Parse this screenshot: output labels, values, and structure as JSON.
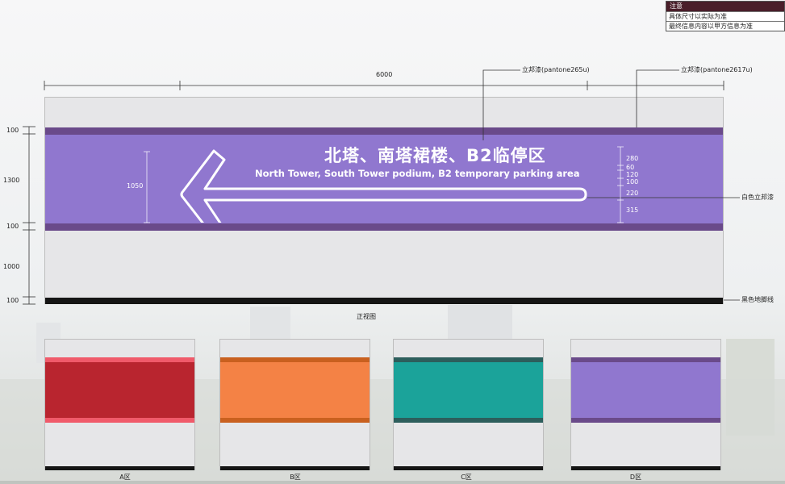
{
  "notice": {
    "title": "注意",
    "lines": [
      "具体尺寸以实际为准",
      "最终信息内容以甲方信息为准"
    ]
  },
  "front_view": {
    "width_dim": "6000",
    "height_dims": [
      "100",
      "1300",
      "100",
      "1000",
      "100"
    ],
    "arrow_height_dim": "1050",
    "text_dims": [
      "280",
      "60",
      "120",
      "100",
      "220",
      "315"
    ],
    "sign_cn": "北塔、南塔裙楼、B2临停区",
    "sign_en": "North Tower, South Tower podium, B2 temporary parking area",
    "callouts": {
      "paint_main": "立邦漆(pantone265u)",
      "paint_stripe": "立邦漆(pantone2617u)",
      "paint_white": "白色立邦漆",
      "baseboard": "黑色地脚线"
    },
    "caption": "正视图"
  },
  "colors": {
    "wall": "#e6e6e8",
    "purple_main": "#9077cf",
    "purple_stripe": "#6a4a8a",
    "baseboard": "#151515"
  },
  "zones": [
    {
      "label": "A区",
      "main": "#b9252f",
      "stripe": "#f05a6a"
    },
    {
      "label": "B区",
      "main": "#f48245",
      "stripe": "#c9601f"
    },
    {
      "label": "C区",
      "main": "#1ba39a",
      "stripe": "#2d5e5c"
    },
    {
      "label": "D区",
      "main": "#9077cf",
      "stripe": "#6a4a8a"
    }
  ]
}
